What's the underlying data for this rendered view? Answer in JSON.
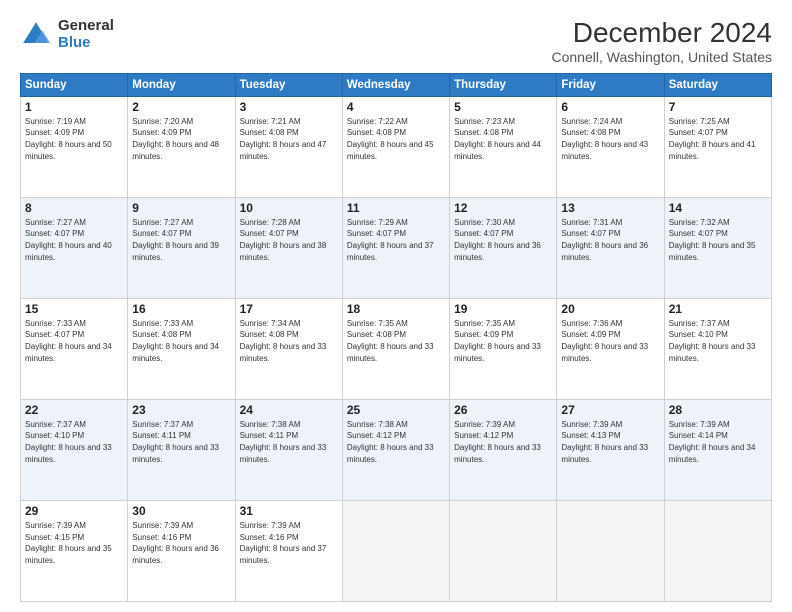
{
  "logo": {
    "general": "General",
    "blue": "Blue"
  },
  "title": "December 2024",
  "location": "Connell, Washington, United States",
  "days_of_week": [
    "Sunday",
    "Monday",
    "Tuesday",
    "Wednesday",
    "Thursday",
    "Friday",
    "Saturday"
  ],
  "weeks": [
    [
      {
        "day": "1",
        "sunrise": "7:19 AM",
        "sunset": "4:09 PM",
        "daylight": "8 hours and 50 minutes."
      },
      {
        "day": "2",
        "sunrise": "7:20 AM",
        "sunset": "4:09 PM",
        "daylight": "8 hours and 48 minutes."
      },
      {
        "day": "3",
        "sunrise": "7:21 AM",
        "sunset": "4:08 PM",
        "daylight": "8 hours and 47 minutes."
      },
      {
        "day": "4",
        "sunrise": "7:22 AM",
        "sunset": "4:08 PM",
        "daylight": "8 hours and 45 minutes."
      },
      {
        "day": "5",
        "sunrise": "7:23 AM",
        "sunset": "4:08 PM",
        "daylight": "8 hours and 44 minutes."
      },
      {
        "day": "6",
        "sunrise": "7:24 AM",
        "sunset": "4:08 PM",
        "daylight": "8 hours and 43 minutes."
      },
      {
        "day": "7",
        "sunrise": "7:25 AM",
        "sunset": "4:07 PM",
        "daylight": "8 hours and 41 minutes."
      }
    ],
    [
      {
        "day": "8",
        "sunrise": "7:27 AM",
        "sunset": "4:07 PM",
        "daylight": "8 hours and 40 minutes."
      },
      {
        "day": "9",
        "sunrise": "7:27 AM",
        "sunset": "4:07 PM",
        "daylight": "8 hours and 39 minutes."
      },
      {
        "day": "10",
        "sunrise": "7:28 AM",
        "sunset": "4:07 PM",
        "daylight": "8 hours and 38 minutes."
      },
      {
        "day": "11",
        "sunrise": "7:29 AM",
        "sunset": "4:07 PM",
        "daylight": "8 hours and 37 minutes."
      },
      {
        "day": "12",
        "sunrise": "7:30 AM",
        "sunset": "4:07 PM",
        "daylight": "8 hours and 36 minutes."
      },
      {
        "day": "13",
        "sunrise": "7:31 AM",
        "sunset": "4:07 PM",
        "daylight": "8 hours and 36 minutes."
      },
      {
        "day": "14",
        "sunrise": "7:32 AM",
        "sunset": "4:07 PM",
        "daylight": "8 hours and 35 minutes."
      }
    ],
    [
      {
        "day": "15",
        "sunrise": "7:33 AM",
        "sunset": "4:07 PM",
        "daylight": "8 hours and 34 minutes."
      },
      {
        "day": "16",
        "sunrise": "7:33 AM",
        "sunset": "4:08 PM",
        "daylight": "8 hours and 34 minutes."
      },
      {
        "day": "17",
        "sunrise": "7:34 AM",
        "sunset": "4:08 PM",
        "daylight": "8 hours and 33 minutes."
      },
      {
        "day": "18",
        "sunrise": "7:35 AM",
        "sunset": "4:08 PM",
        "daylight": "8 hours and 33 minutes."
      },
      {
        "day": "19",
        "sunrise": "7:35 AM",
        "sunset": "4:09 PM",
        "daylight": "8 hours and 33 minutes."
      },
      {
        "day": "20",
        "sunrise": "7:36 AM",
        "sunset": "4:09 PM",
        "daylight": "8 hours and 33 minutes."
      },
      {
        "day": "21",
        "sunrise": "7:37 AM",
        "sunset": "4:10 PM",
        "daylight": "8 hours and 33 minutes."
      }
    ],
    [
      {
        "day": "22",
        "sunrise": "7:37 AM",
        "sunset": "4:10 PM",
        "daylight": "8 hours and 33 minutes."
      },
      {
        "day": "23",
        "sunrise": "7:37 AM",
        "sunset": "4:11 PM",
        "daylight": "8 hours and 33 minutes."
      },
      {
        "day": "24",
        "sunrise": "7:38 AM",
        "sunset": "4:11 PM",
        "daylight": "8 hours and 33 minutes."
      },
      {
        "day": "25",
        "sunrise": "7:38 AM",
        "sunset": "4:12 PM",
        "daylight": "8 hours and 33 minutes."
      },
      {
        "day": "26",
        "sunrise": "7:39 AM",
        "sunset": "4:12 PM",
        "daylight": "8 hours and 33 minutes."
      },
      {
        "day": "27",
        "sunrise": "7:39 AM",
        "sunset": "4:13 PM",
        "daylight": "8 hours and 33 minutes."
      },
      {
        "day": "28",
        "sunrise": "7:39 AM",
        "sunset": "4:14 PM",
        "daylight": "8 hours and 34 minutes."
      }
    ],
    [
      {
        "day": "29",
        "sunrise": "7:39 AM",
        "sunset": "4:15 PM",
        "daylight": "8 hours and 35 minutes."
      },
      {
        "day": "30",
        "sunrise": "7:39 AM",
        "sunset": "4:16 PM",
        "daylight": "8 hours and 36 minutes."
      },
      {
        "day": "31",
        "sunrise": "7:39 AM",
        "sunset": "4:16 PM",
        "daylight": "8 hours and 37 minutes."
      },
      null,
      null,
      null,
      null
    ]
  ],
  "labels": {
    "sunrise": "Sunrise:",
    "sunset": "Sunset:",
    "daylight": "Daylight:"
  }
}
